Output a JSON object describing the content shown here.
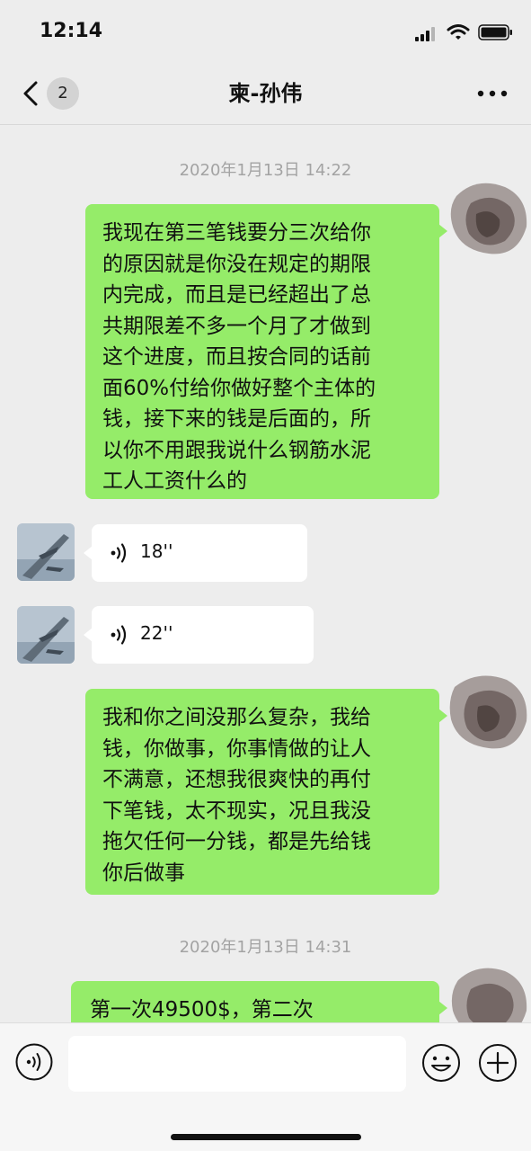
{
  "status": {
    "time": "12:14"
  },
  "nav": {
    "unread_count": "2",
    "title": "柬-孙伟"
  },
  "messages": {
    "ts1": "2020年1月13日 14:22",
    "m1": {
      "lines": [
        "我现在第三笔钱要分三次给你",
        "的原因就是你没在规定的期限",
        "内完成，而且是已经超出了总",
        "共期限差不多一个月了才做到",
        "这个进度，而且按合同的话前",
        "面60%付给你做好整个主体的",
        "钱，接下来的钱是后面的，所",
        "以你不用跟我说什么钢筋水泥",
        "工人工资什么的"
      ]
    },
    "v1": {
      "duration": "18''"
    },
    "v2": {
      "duration": "22''"
    },
    "m2": {
      "lines": [
        "我和你之间没那么复杂，我给",
        "钱，你做事，你事情做的让人",
        "不满意，还想我很爽快的再付",
        "下笔钱，太不现实，况且我没",
        "拖欠任何一分钱，都是先给钱",
        "你后做事"
      ]
    },
    "ts2": "2020年1月13日 14:31",
    "m3": {
      "lines": [
        "第一次49500$，第二次"
      ]
    }
  },
  "icons": {
    "back": "chevron-left-icon",
    "more": "more-icon",
    "voice": "voice-wave-icon",
    "emoji": "emoji-icon",
    "plus": "plus-icon"
  },
  "colors": {
    "bubble_out": "#95ec69",
    "bubble_in": "#ffffff",
    "background": "#ededed",
    "timestamp": "#a3a3a3"
  }
}
